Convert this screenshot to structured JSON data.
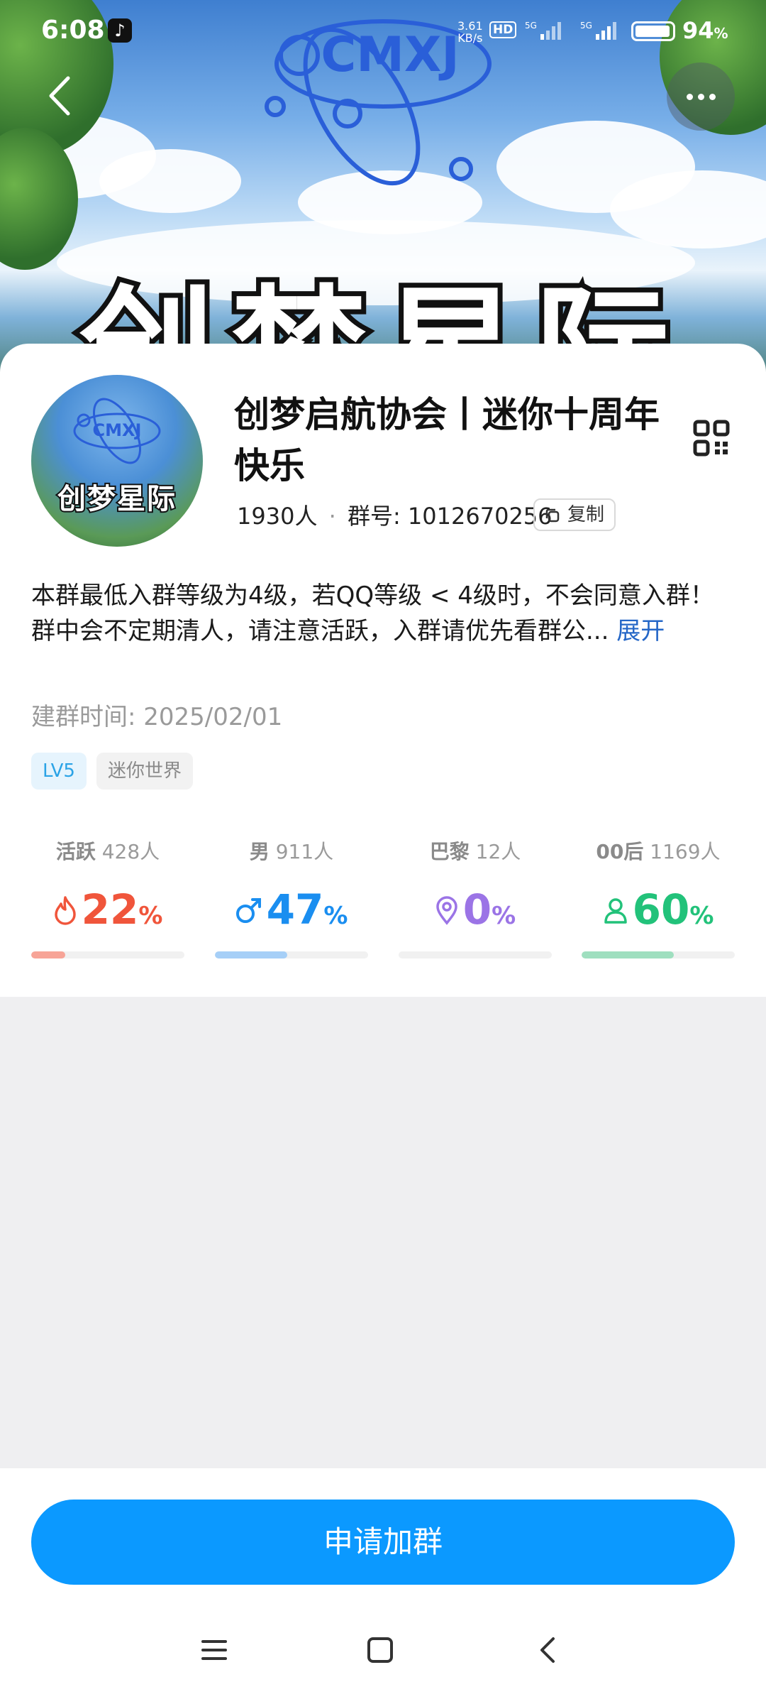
{
  "status_bar": {
    "time": "6:08",
    "net_speed_top": "3.61",
    "net_speed_bottom": "KB/s",
    "hd": "HD",
    "sig1": "5G",
    "sig2": "5G",
    "battery": "94",
    "battery_unit": "%"
  },
  "hero": {
    "logo_text": "CMXJ",
    "title": "创梦星际"
  },
  "group": {
    "avatar_logo": "CMXJ",
    "avatar_title": "创梦星际",
    "name": "创梦启航协会丨迷你十周年快乐",
    "members": "1930人",
    "separator": "·",
    "id_label": "群号: 1012670256",
    "copy_label": "复制",
    "description_line1": "本群最低入群等级为4级，若QQ等级 < 4级时，不会同意入群！",
    "description_line2": "群中会不定期清人，请注意活跃，入群请优先看群公...",
    "expand_label": "展开",
    "created": "建群时间: 2025/02/01",
    "tags": [
      "LV5",
      "迷你世界"
    ]
  },
  "stats": [
    {
      "label": "活跃",
      "count": "428人",
      "value": "22",
      "unit": "%",
      "percent": 22,
      "color": "#f0553b",
      "bar_color": "#f7a497",
      "icon": "flame-icon"
    },
    {
      "label": "男",
      "count": "911人",
      "value": "47",
      "unit": "%",
      "percent": 47,
      "color": "#1a8ef0",
      "bar_color": "#a6cff7",
      "icon": "male-icon"
    },
    {
      "label": "巴黎",
      "count": "12人",
      "value": "0",
      "unit": "%",
      "percent": 0,
      "color": "#9b74e6",
      "bar_color": "#cbb6f3",
      "icon": "location-pin-icon"
    },
    {
      "label": "00后",
      "count": "1169人",
      "value": "60",
      "unit": "%",
      "percent": 60,
      "color": "#22c27a",
      "bar_color": "#9fdfbf",
      "icon": "person-icon"
    }
  ],
  "join_button": "申请加群",
  "colors": {
    "accent": "#0b99ff",
    "link": "#2567c7"
  }
}
